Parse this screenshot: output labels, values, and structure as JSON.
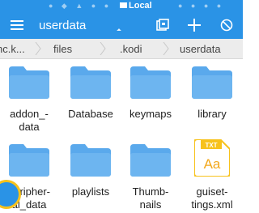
{
  "status_bar": {
    "location_label": "Local"
  },
  "toolbar": {
    "title": "userdata"
  },
  "breadcrumb": [
    {
      "label": "nc.k..."
    },
    {
      "label": "files"
    },
    {
      "label": ".kodi"
    },
    {
      "label": "userdata"
    }
  ],
  "files": [
    {
      "name": "addon_-\ndata",
      "type": "folder",
      "icon": "folder-icon"
    },
    {
      "name": "Database",
      "type": "folder",
      "icon": "folder-icon"
    },
    {
      "name": "keymaps",
      "type": "folder",
      "icon": "folder-icon"
    },
    {
      "name": "library",
      "type": "folder",
      "icon": "folder-icon"
    },
    {
      "name": "peripher-\nal_data",
      "type": "folder",
      "icon": "folder-icon"
    },
    {
      "name": "playlists",
      "type": "folder",
      "icon": "folder-icon"
    },
    {
      "name": "Thumb-\nnails",
      "type": "folder",
      "icon": "folder-icon"
    },
    {
      "name": "guiset-\ntings.xml",
      "type": "file",
      "icon": "txt-file-icon",
      "badge": "TXT",
      "glyph": "Aa"
    }
  ],
  "colors": {
    "accent": "#2a93e6",
    "folder": "#5aa9ec",
    "file_icon": "#f7c21c"
  }
}
